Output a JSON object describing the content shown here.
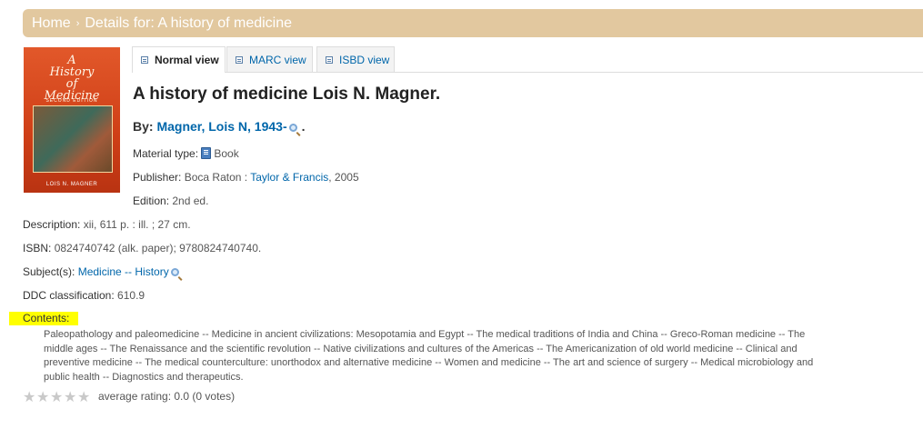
{
  "breadcrumb": {
    "home": "Home",
    "separator": "›",
    "current": "Details for: A history of medicine"
  },
  "cover": {
    "title_line1": "A",
    "title_line2": "History",
    "title_line3": "of",
    "title_line4": "Medicine",
    "edition": "SECOND EDITION",
    "author": "LOIS N. MAGNER"
  },
  "tabs": [
    {
      "label": "Normal view",
      "active": true,
      "icon": "document-icon"
    },
    {
      "label": "MARC view",
      "active": false,
      "icon": "list-icon"
    },
    {
      "label": "ISBD view",
      "active": false,
      "icon": "card-icon"
    }
  ],
  "record": {
    "title": "A history of medicine Lois N. Magner.",
    "by_label": "By:",
    "author_link": "Magner, Lois N, 1943-",
    "author_suffix": ".",
    "material_type_label": "Material type:",
    "material_type_value": "Book",
    "publisher_label": "Publisher:",
    "publisher_place": "Boca Raton :",
    "publisher_name": "Taylor & Francis",
    "publisher_year": ", 2005",
    "edition_label": "Edition:",
    "edition_value": "2nd ed.",
    "description_label": "Description:",
    "description_value": "xii, 611 p. : ill. ; 27 cm.",
    "isbn_label": "ISBN:",
    "isbn_value": "0824740742 (alk. paper); 9780824740740.",
    "subjects_label": "Subject(s):",
    "subjects_link": "Medicine -- History",
    "ddc_label": "DDC classification:",
    "ddc_value": "610.9",
    "contents_label": "Contents:",
    "contents_value": "Paleopathology and paleomedicine -- Medicine in ancient civilizations: Mesopotamia and Egypt -- The medical traditions of India and China -- Greco-Roman medicine -- The middle ages -- The Renaissance and the scientific revolution -- Native civilizations and cultures of the Americas -- The Americanization of old world medicine -- Clinical and preventive medicine -- The medical counterculture: unorthodox and alternative medicine -- Women and medicine -- The art and science of surgery -- Medical microbiology and public health -- Diagnostics and therapeutics."
  },
  "rating": {
    "stars": 0,
    "max_stars": 5,
    "text": "average rating: 0.0 (0 votes)"
  },
  "colors": {
    "breadcrumb_bg": "#e2c89f",
    "link": "#0066aa",
    "highlight": "#ffff00"
  }
}
